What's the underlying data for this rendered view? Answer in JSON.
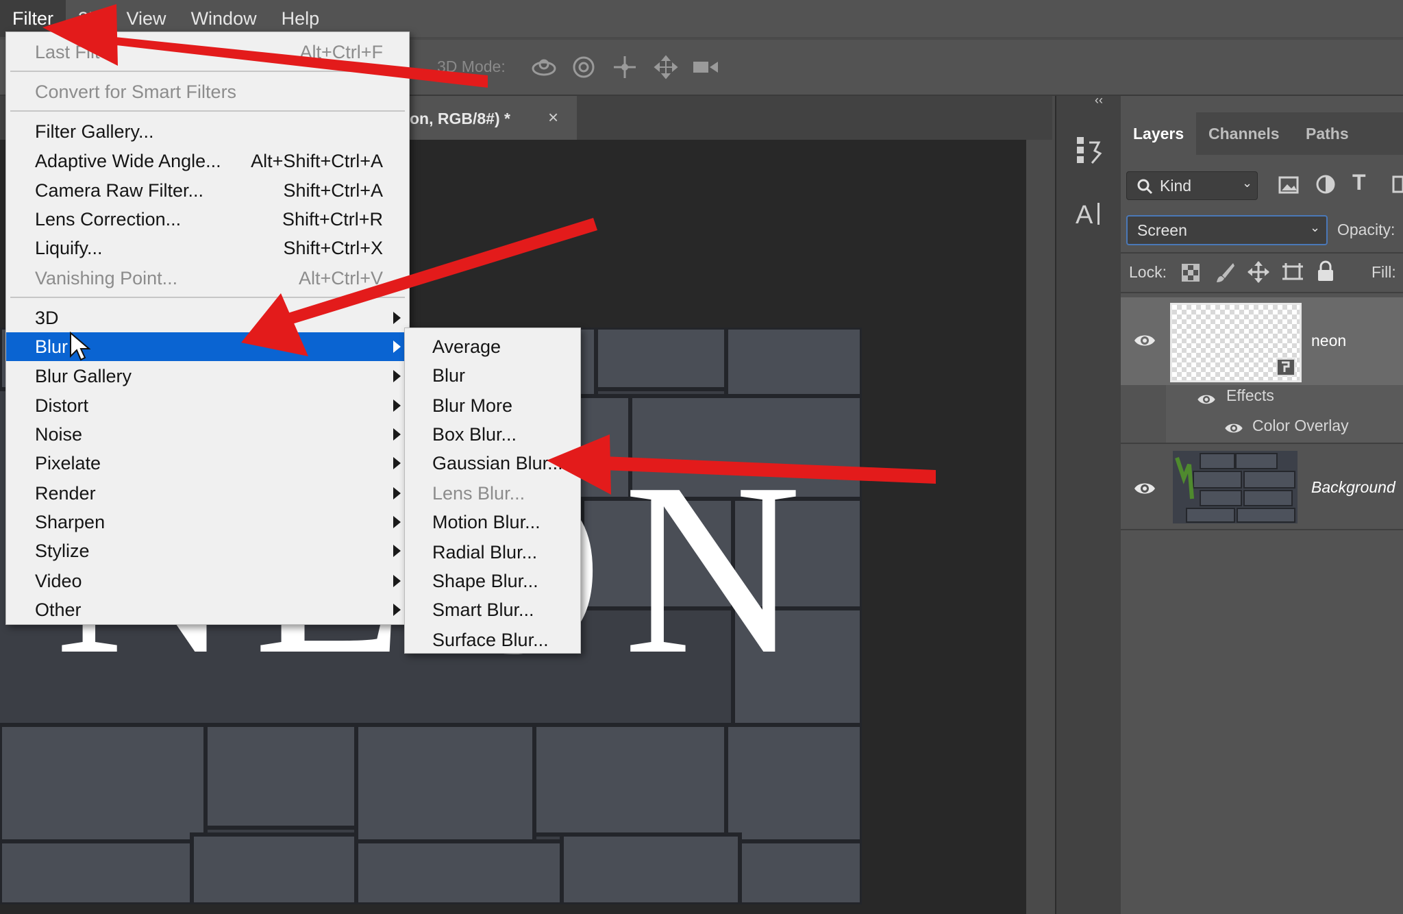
{
  "menubar": {
    "items": [
      "Filter",
      "3D",
      "View",
      "Window",
      "Help"
    ]
  },
  "options_bar": {
    "mode_label": "3D Mode:"
  },
  "document_tab": {
    "title": "on, RGB/8#) *",
    "close_glyph": "×"
  },
  "canvas": {
    "artwork_text": "NEON"
  },
  "filter_menu": {
    "last_filter": {
      "label": "Last Filter",
      "shortcut": "Alt+Ctrl+F"
    },
    "convert_smart": "Convert for Smart Filters",
    "items": [
      {
        "label": "Filter Gallery...",
        "shortcut": ""
      },
      {
        "label": "Adaptive Wide Angle...",
        "shortcut": "Alt+Shift+Ctrl+A"
      },
      {
        "label": "Camera Raw Filter...",
        "shortcut": "Shift+Ctrl+A"
      },
      {
        "label": "Lens Correction...",
        "shortcut": "Shift+Ctrl+R"
      },
      {
        "label": "Liquify...",
        "shortcut": "Shift+Ctrl+X"
      },
      {
        "label": "Vanishing Point...",
        "shortcut": "Alt+Ctrl+V"
      }
    ],
    "submenus": [
      "3D",
      "Blur",
      "Blur Gallery",
      "Distort",
      "Noise",
      "Pixelate",
      "Render",
      "Sharpen",
      "Stylize",
      "Video",
      "Other"
    ]
  },
  "blur_submenu": {
    "items": [
      "Average",
      "Blur",
      "Blur More",
      "Box Blur...",
      "Gaussian Blur...",
      "Lens Blur...",
      "Motion Blur...",
      "Radial Blur...",
      "Shape Blur...",
      "Smart Blur...",
      "Surface Blur..."
    ]
  },
  "layers_panel": {
    "tabs": [
      "Layers",
      "Channels",
      "Paths"
    ],
    "kind_label": "Kind",
    "blend_mode": "Screen",
    "opacity_label": "Opacity:",
    "lock_label": "Lock:",
    "fill_label": "Fill:",
    "layers": [
      {
        "name": "neon",
        "effects_label": "Effects",
        "effect": "Color Overlay"
      },
      {
        "name": "Background"
      }
    ]
  },
  "colors": {
    "highlight": "#0a64d2",
    "annotation_arrow": "#e31b1b"
  }
}
